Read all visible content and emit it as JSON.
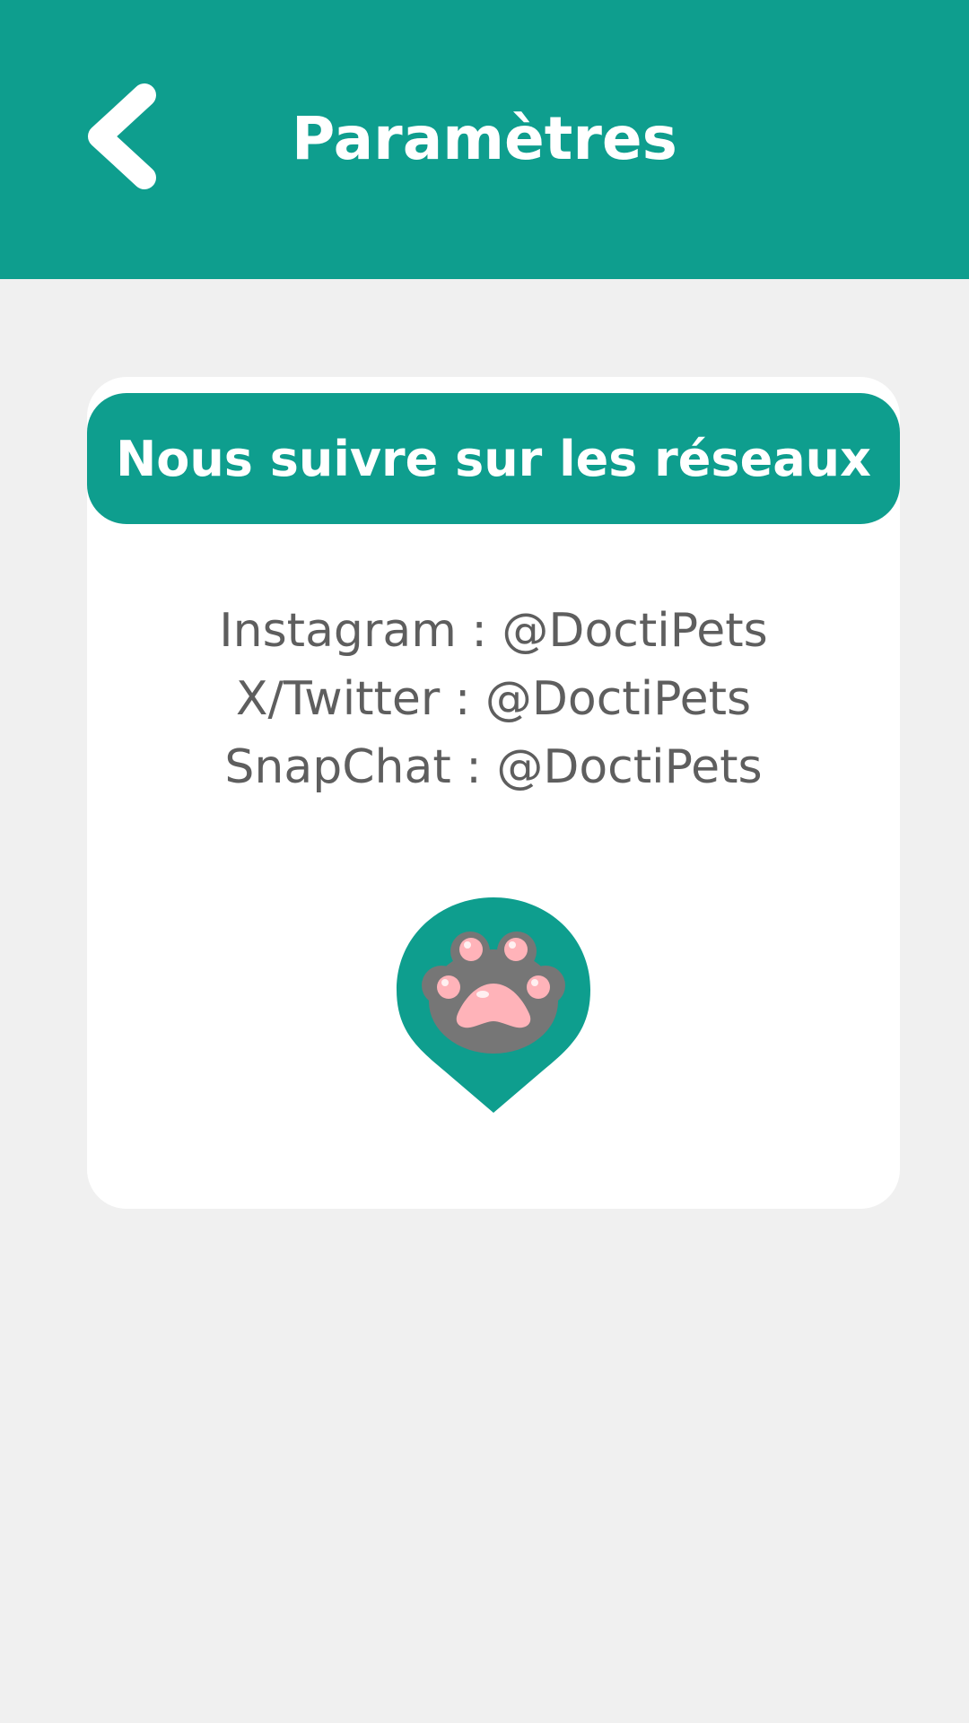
{
  "header": {
    "title": "Paramètres",
    "back_icon": "chevron-left-icon"
  },
  "card": {
    "title": "Nous suivre sur les réseaux",
    "social": [
      {
        "text": "Instagram : @DoctiPets"
      },
      {
        "text": "X/Twitter : @DoctiPets"
      },
      {
        "text": "SnapChat : @DoctiPets"
      }
    ],
    "logo_icon": "paw-pin-icon"
  },
  "colors": {
    "accent": "#0e9e8e",
    "background": "#f0f0f0",
    "card": "#ffffff",
    "text_secondary": "#5e5e5e",
    "paw": "#767676",
    "paw_pads": "#ffb3b9"
  }
}
